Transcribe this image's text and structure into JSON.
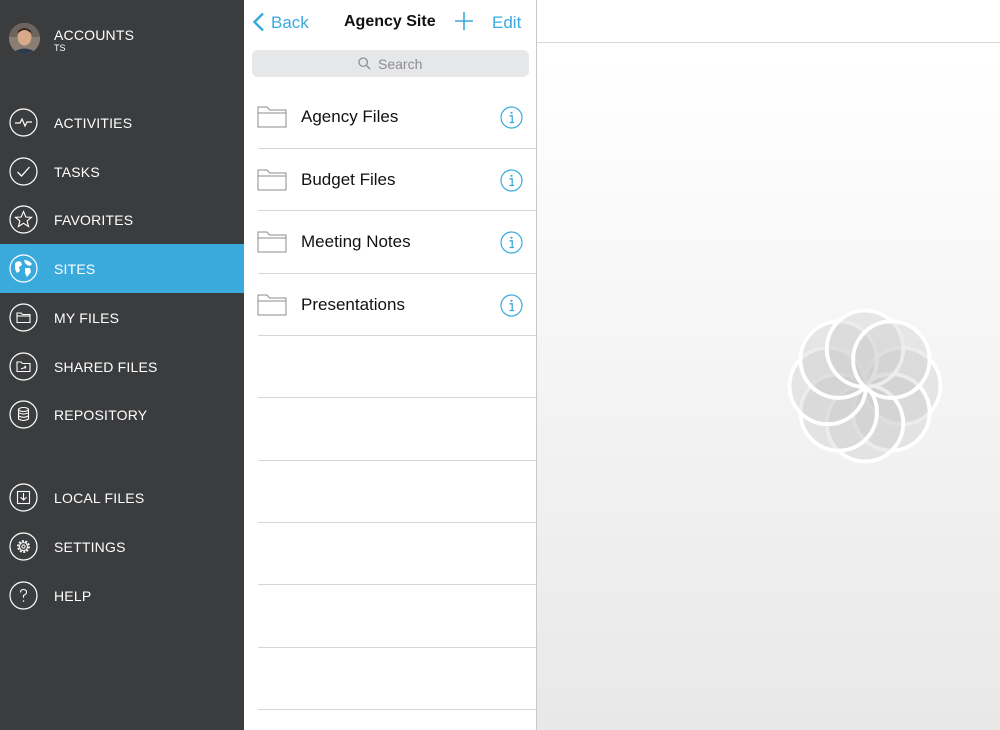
{
  "sidebar": {
    "account": {
      "title": "ACCOUNTS",
      "subtitle": "TS"
    },
    "items": [
      {
        "label": "ACTIVITIES",
        "icon": "activity-icon"
      },
      {
        "label": "TASKS",
        "icon": "checkmark-icon"
      },
      {
        "label": "FAVORITES",
        "icon": "star-icon"
      },
      {
        "label": "SITES",
        "icon": "globe-icon",
        "selected": true
      },
      {
        "label": "MY FILES",
        "icon": "folder-icon"
      },
      {
        "label": "SHARED FILES",
        "icon": "shared-folder-icon"
      },
      {
        "label": "REPOSITORY",
        "icon": "database-icon"
      },
      {
        "label": "LOCAL FILES",
        "icon": "download-tray-icon"
      },
      {
        "label": "SETTINGS",
        "icon": "gear-icon"
      },
      {
        "label": "HELP",
        "icon": "question-icon"
      }
    ]
  },
  "navbar": {
    "back_label": "Back",
    "title": "Agency Site",
    "edit_label": "Edit"
  },
  "search": {
    "placeholder": "Search"
  },
  "folders": [
    {
      "name": "Agency Files"
    },
    {
      "name": "Budget Files"
    },
    {
      "name": "Meeting Notes"
    },
    {
      "name": "Presentations"
    }
  ],
  "colors": {
    "accent": "#3aaadc",
    "sidebar_bg": "#3b3c3e",
    "selected_bg": "#3aaadc"
  }
}
